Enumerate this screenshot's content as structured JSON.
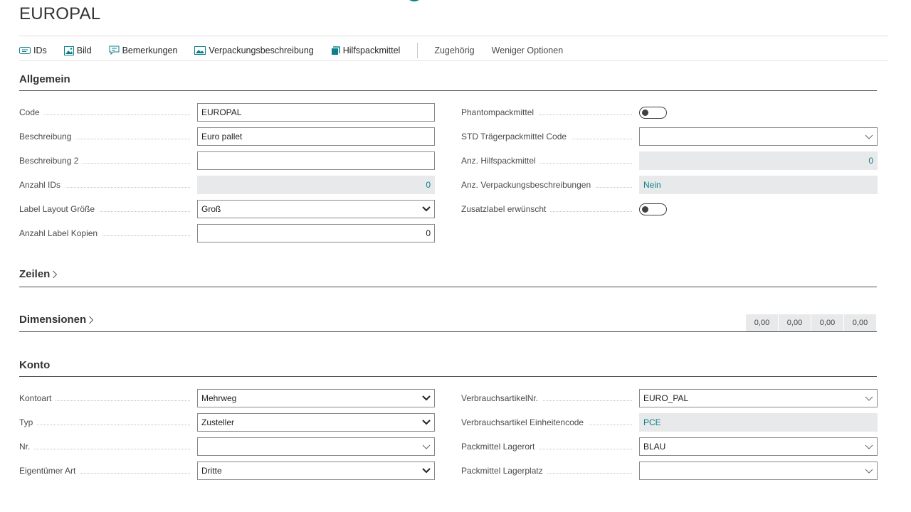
{
  "page": {
    "title": "EUROPAL"
  },
  "actions": {
    "ids": "IDs",
    "bild": "Bild",
    "bemerkungen": "Bemerkungen",
    "verpackungsbeschreibung": "Verpackungsbeschreibung",
    "hilfspackmittel": "Hilfspackmittel",
    "zugehoerig": "Zugehörig",
    "weniger_optionen": "Weniger Optionen"
  },
  "sections": {
    "allgemein": "Allgemein",
    "zeilen": "Zeilen",
    "dimensionen": "Dimensionen",
    "konto": "Konto"
  },
  "allgemein": {
    "code": {
      "label": "Code",
      "value": "EUROPAL"
    },
    "beschreibung": {
      "label": "Beschreibung",
      "value": "Euro pallet"
    },
    "beschreibung2": {
      "label": "Beschreibung 2",
      "value": ""
    },
    "anzahl_ids": {
      "label": "Anzahl IDs",
      "value": "0"
    },
    "label_layout": {
      "label": "Label Layout Größe",
      "value": "Groß"
    },
    "anzahl_label_kopien": {
      "label": "Anzahl Label Kopien",
      "value": "0"
    },
    "phantompackmittel": {
      "label": "Phantompackmittel",
      "checked": false
    },
    "std_traeger": {
      "label": "STD Trägerpackmittel Code",
      "value": ""
    },
    "anz_hilfspackmittel": {
      "label": "Anz. Hilfspackmittel",
      "value": "0"
    },
    "anz_verpackungsbeschreibungen": {
      "label": "Anz. Verpackungsbeschreibungen",
      "value": "Nein"
    },
    "zusatzlabel": {
      "label": "Zusatzlabel erwünscht",
      "checked": false
    }
  },
  "dimension_totals": [
    "0,00",
    "0,00",
    "0,00",
    "0,00"
  ],
  "konto": {
    "kontoart": {
      "label": "Kontoart",
      "value": "Mehrweg"
    },
    "typ": {
      "label": "Typ",
      "value": "Zusteller"
    },
    "nr": {
      "label": "Nr.",
      "value": ""
    },
    "eigentuemer_art": {
      "label": "Eigentümer Art",
      "value": "Dritte"
    },
    "verbrauchsartikel_nr": {
      "label": "VerbrauchsartikelNr.",
      "value": "EURO_PAL"
    },
    "verbrauchsartikel_einheitencode": {
      "label": "Verbrauchsartikel Einheitencode",
      "value": "PCE"
    },
    "packmittel_lagerort": {
      "label": "Packmittel Lagerort",
      "value": "BLAU"
    },
    "packmittel_lagerplatz": {
      "label": "Packmittel Lagerplatz",
      "value": ""
    }
  },
  "colors": {
    "accent": "#0b7f8a",
    "readonly_bg": "#e8e9ea",
    "text": "#212121"
  }
}
